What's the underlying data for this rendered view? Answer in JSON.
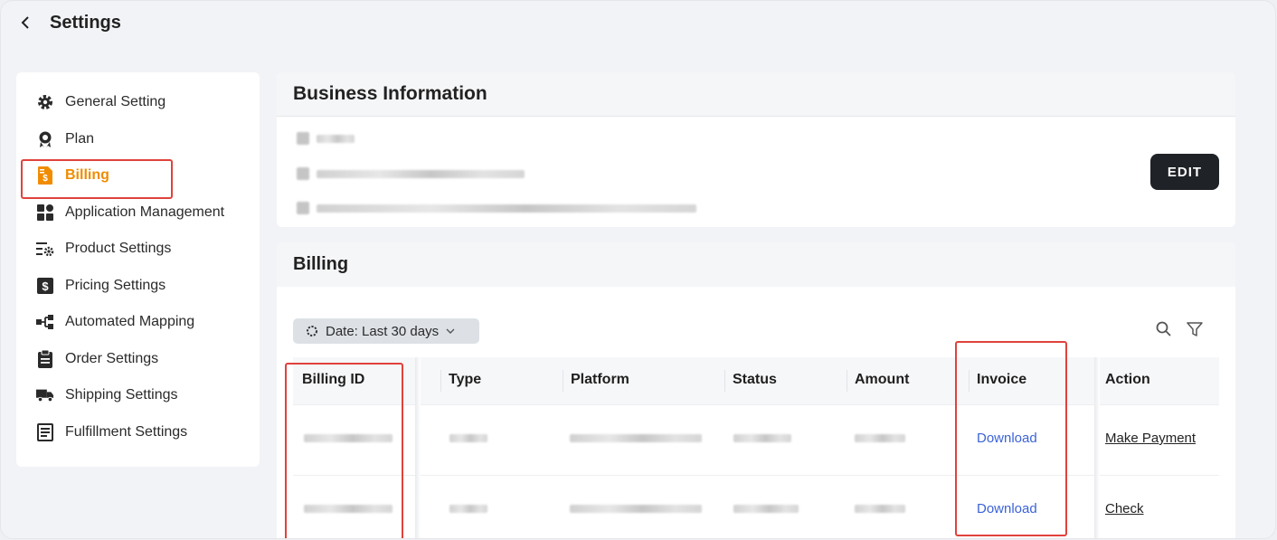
{
  "header": {
    "title": "Settings"
  },
  "sidebar": {
    "items": [
      {
        "label": "General Setting",
        "icon": "gear-icon"
      },
      {
        "label": "Plan",
        "icon": "award-icon"
      },
      {
        "label": "Billing",
        "icon": "invoice-dollar-icon",
        "active": true
      },
      {
        "label": "Application Management",
        "icon": "apps-grid-icon"
      },
      {
        "label": "Product Settings",
        "icon": "list-gear-icon"
      },
      {
        "label": "Pricing Settings",
        "icon": "dollar-box-icon"
      },
      {
        "label": "Automated Mapping",
        "icon": "mapping-icon"
      },
      {
        "label": "Order Settings",
        "icon": "clipboard-icon"
      },
      {
        "label": "Shipping Settings",
        "icon": "truck-icon"
      },
      {
        "label": "Fulfillment Settings",
        "icon": "document-list-icon"
      }
    ]
  },
  "business": {
    "title": "Business Information",
    "edit_label": "EDIT"
  },
  "billing": {
    "title": "Billing",
    "date_filter": "Date: Last 30 days",
    "columns": [
      "Billing ID",
      "Type",
      "Platform",
      "Status",
      "Amount",
      "Invoice",
      "Action"
    ],
    "rows": [
      {
        "invoice": "Download",
        "action": "Make Payment"
      },
      {
        "invoice": "Download",
        "action": "Check"
      }
    ]
  },
  "colors": {
    "accent": "#f08c00",
    "highlight": "#e0423c",
    "link": "#3b63d6",
    "button": "#1f2327"
  }
}
